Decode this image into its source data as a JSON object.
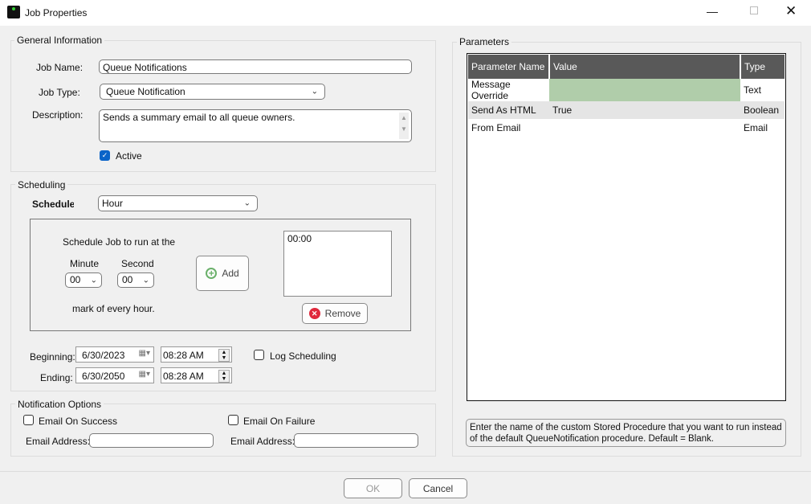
{
  "window": {
    "title": "Job Properties",
    "logo_text": "SPC"
  },
  "general": {
    "legend": "General Information",
    "job_name_label": "Job Name:",
    "job_name": "Queue Notifications",
    "job_type_label": "Job Type:",
    "job_type": "Queue Notification",
    "description_label": "Description:",
    "description": "Sends a summary email to all queue owners.",
    "active_label": "Active",
    "active": true
  },
  "scheduling": {
    "legend": "Scheduling",
    "schedule_label": "Schedule",
    "schedule": "Hour",
    "run_at_text": "Schedule Job to run at the",
    "minute_label": "Minute",
    "minute": "00",
    "second_label": "Second",
    "second": "00",
    "mark_text": "mark of every hour.",
    "add_label": "Add",
    "times": [
      "00:00"
    ],
    "remove_label": "Remove",
    "beginning_label": "Beginning:",
    "beginning_date": "6/30/2023",
    "beginning_time": "08:28 AM",
    "ending_label": "Ending:",
    "ending_date": "6/30/2050",
    "ending_time": "08:28 AM",
    "log_label": "Log Scheduling",
    "log": false
  },
  "notification": {
    "legend": "Notification Options",
    "success_label": "Email On Success",
    "failure_label": "Email On Failure",
    "email_label_1": "Email Address:",
    "email_label_2": "Email Address:",
    "email_1": "",
    "email_2": ""
  },
  "parameters": {
    "legend": "Parameters",
    "columns": [
      "Parameter Name",
      "Value",
      "Type"
    ],
    "rows": [
      {
        "name": "Message Override",
        "value": "",
        "type": "Text"
      },
      {
        "name": "Send As HTML",
        "value": "True",
        "type": "Boolean"
      },
      {
        "name": "From Email",
        "value": "",
        "type": "Email"
      }
    ],
    "hint": "Enter the name of the custom Stored Procedure that you want to run instead of the default QueueNotification procedure. Default = Blank.",
    "selected_color": "#b0cdaa"
  },
  "footer": {
    "ok": "OK",
    "cancel": "Cancel"
  }
}
